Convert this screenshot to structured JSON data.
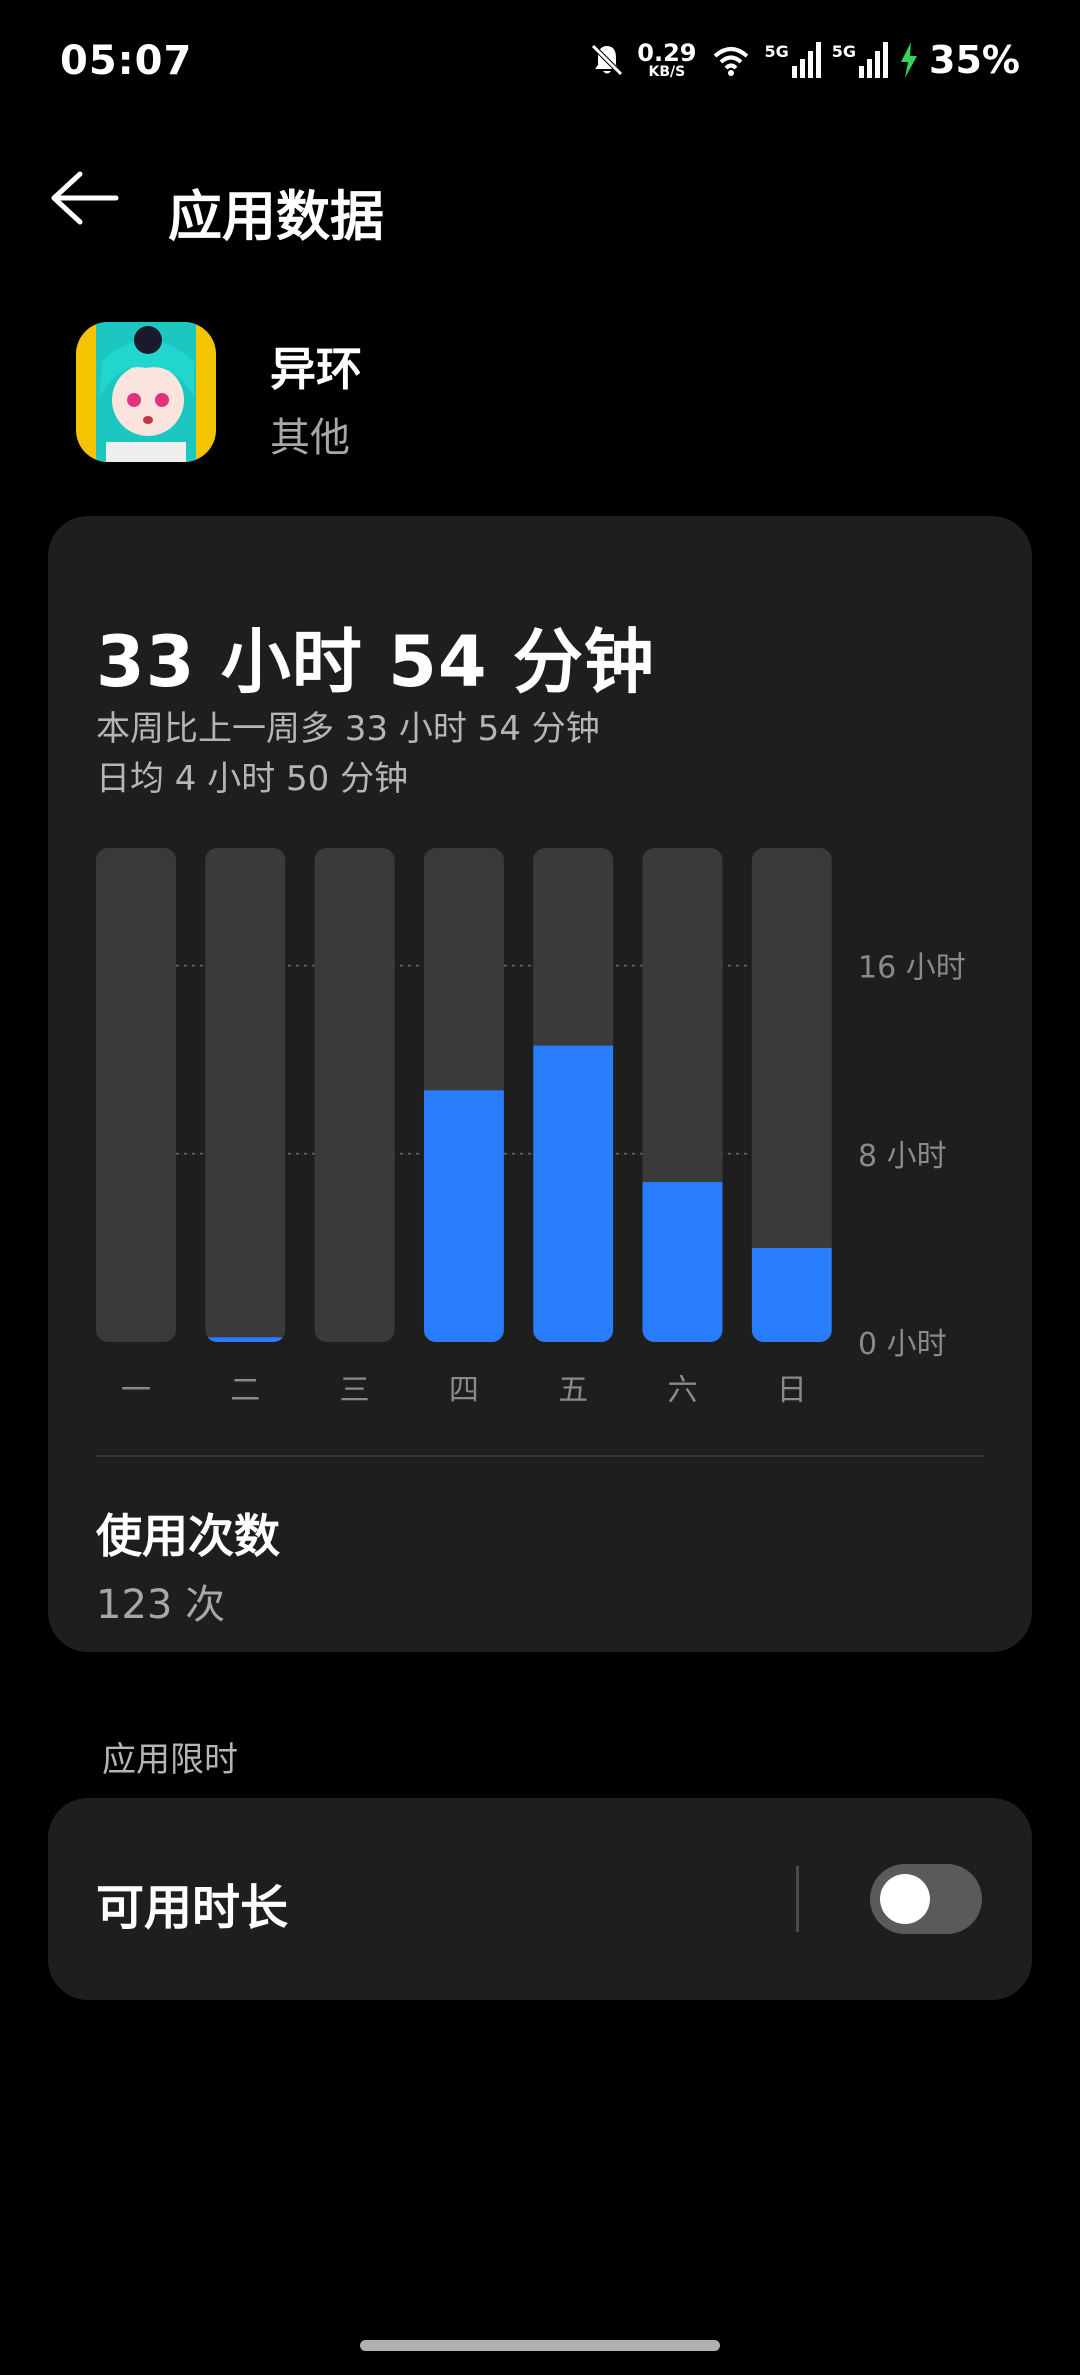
{
  "status_bar": {
    "time": "05:07",
    "net_speed_value": "0.29",
    "net_speed_unit": "KB/S",
    "signal_1_label": "5G",
    "signal_2_label": "5G",
    "battery": "35%"
  },
  "header": {
    "title": "应用数据"
  },
  "app": {
    "name": "异环",
    "category": "其他"
  },
  "usage": {
    "total": "33 小时 54 分钟",
    "comparison": "本周比上一周多 33 小时 54 分钟",
    "daily_avg": "日均 4 小时 50 分钟"
  },
  "chart_data": {
    "type": "bar",
    "categories": [
      "一",
      "二",
      "三",
      "四",
      "五",
      "六",
      "日"
    ],
    "values": [
      0,
      0.2,
      0,
      10.7,
      12.6,
      6.8,
      4
    ],
    "y_ticks": [
      {
        "value": 0,
        "label": "0 小时"
      },
      {
        "value": 8,
        "label": "8 小时"
      },
      {
        "value": 16,
        "label": "16 小时"
      }
    ],
    "ylim": [
      0,
      21
    ],
    "colors": {
      "bar": "#2a7cff",
      "track": "#3a3a3a",
      "grid": "#5a5a5a"
    }
  },
  "launches": {
    "title": "使用次数",
    "value": "123 次"
  },
  "limit_section": {
    "label": "应用限时",
    "item_label": "可用时长",
    "toggle_on": false
  }
}
